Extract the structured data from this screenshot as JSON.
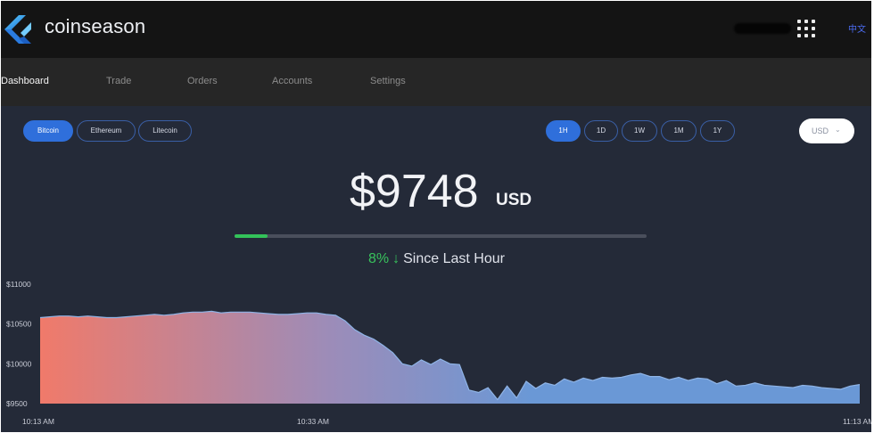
{
  "app": {
    "brand": "coinseason",
    "language_label": "中文"
  },
  "nav": {
    "items": [
      {
        "label": "Dashboard",
        "active": true
      },
      {
        "label": "Trade",
        "active": false
      },
      {
        "label": "Orders",
        "active": false
      },
      {
        "label": "Accounts",
        "active": false
      },
      {
        "label": "Settings",
        "active": false
      }
    ]
  },
  "coins": [
    {
      "label": "Bitcoin",
      "active": true
    },
    {
      "label": "Ethereum",
      "active": false
    },
    {
      "label": "Litecoin",
      "active": false
    }
  ],
  "timeframes": [
    {
      "label": "1H",
      "active": true
    },
    {
      "label": "1D",
      "active": false
    },
    {
      "label": "1W",
      "active": false
    },
    {
      "label": "1M",
      "active": false
    },
    {
      "label": "1Y",
      "active": false
    }
  ],
  "currency_select": {
    "value": "USD"
  },
  "price": {
    "value": "$9748",
    "unit": "USD"
  },
  "change": {
    "percent": "8%",
    "arrow": "↓",
    "label": "Since Last Hour",
    "progress": 0.08
  },
  "colors": {
    "accent": "#2f6fdb",
    "positive": "#38c25c",
    "line_start": "#f07a6a",
    "line_end": "#6a98d6"
  },
  "chart_data": {
    "type": "area",
    "yticks": [
      "$11000",
      "$10500",
      "$10000",
      "$9500"
    ],
    "ylim": [
      9500,
      11000
    ],
    "xticks": [
      "10:13 AM",
      "10:33 AM",
      "11:13 AM"
    ],
    "grid": false,
    "series": [
      {
        "values": [
          10580,
          10590,
          10600,
          10600,
          10590,
          10600,
          10590,
          10580,
          10580,
          10590,
          10600,
          10610,
          10620,
          10610,
          10620,
          10640,
          10650,
          10650,
          10660,
          10640,
          10650,
          10650,
          10650,
          10640,
          10630,
          10620,
          10620,
          10630,
          10640,
          10640,
          10620,
          10610,
          10540,
          10430,
          10360,
          10310,
          10230,
          10140,
          10000,
          9970,
          10050,
          9990,
          10060,
          10000,
          9990,
          9670,
          9640,
          9700,
          9550,
          9720,
          9570,
          9780,
          9690,
          9760,
          9730,
          9810,
          9770,
          9820,
          9790,
          9830,
          9820,
          9830,
          9860,
          9880,
          9840,
          9840,
          9800,
          9830,
          9790,
          9820,
          9810,
          9750,
          9790,
          9720,
          9730,
          9760,
          9730,
          9720,
          9710,
          9700,
          9730,
          9720,
          9700,
          9690,
          9680,
          9720,
          9740
        ]
      }
    ]
  }
}
